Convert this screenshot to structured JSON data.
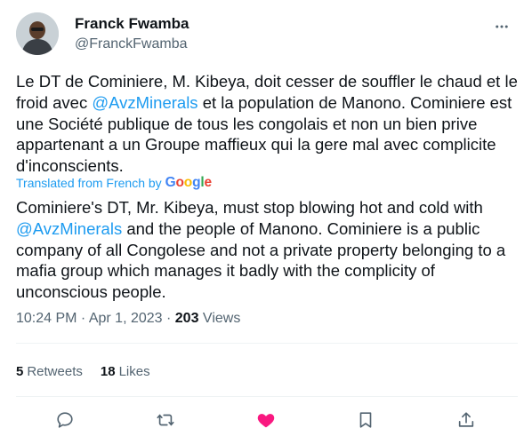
{
  "author": {
    "name": "Franck Fwamba",
    "handle": "@FranckFwamba"
  },
  "tweet": {
    "part1": "Le DT de Cominiere, M. Kibeya, doit cesser de souffler le chaud et le froid avec ",
    "mention": "@AvzMinerals",
    "part2": " et la population de Manono. Cominiere est une Société publique de tous les congolais et non un bien prive appartenant a un Groupe maffieux qui la gere mal avec complicite d'inconscients."
  },
  "translation": {
    "label": "Translated from French by",
    "brand": [
      "G",
      "o",
      "o",
      "g",
      "l",
      "e"
    ],
    "part1": "Cominiere's DT, Mr. Kibeya, must stop blowing hot and cold with ",
    "mention": "@AvzMinerals",
    "part2": " and the people of Manono. Cominiere is a public company of all Congolese and not a private property belonging to a mafia group which manages it badly with the complicity of unconscious people."
  },
  "meta": {
    "time": "10:24 PM",
    "sep1": " · ",
    "date": "Apr 1, 2023",
    "sep2": " · ",
    "views_count": "203",
    "views_label": " Views"
  },
  "stats": {
    "retweets_count": "5",
    "retweets_label": "Retweets",
    "likes_count": "18",
    "likes_label": "Likes"
  },
  "colors": {
    "link": "#1d9bf0",
    "like_active": "#f91880",
    "muted": "#536471"
  },
  "icons": [
    "more-icon",
    "reply-icon",
    "retweet-icon",
    "like-icon",
    "bookmark-icon",
    "share-icon"
  ]
}
